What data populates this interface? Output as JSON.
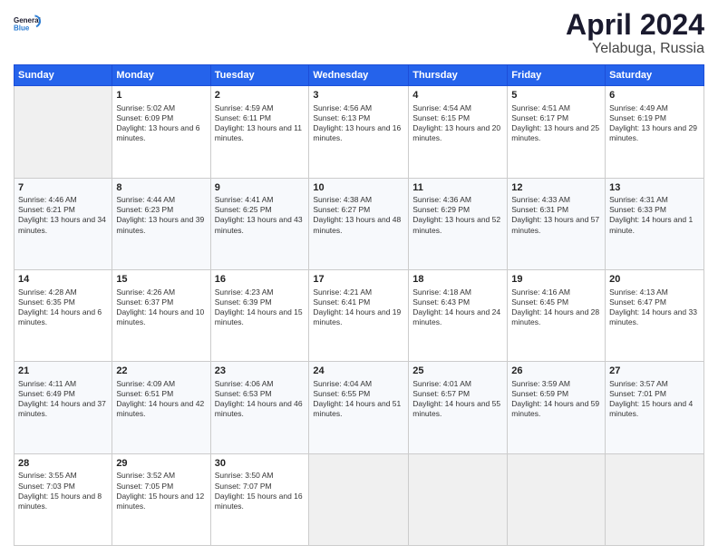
{
  "logo": {
    "text_general": "General",
    "text_blue": "Blue"
  },
  "header": {
    "title": "April 2024",
    "subtitle": "Yelabuga, Russia"
  },
  "weekdays": [
    "Sunday",
    "Monday",
    "Tuesday",
    "Wednesday",
    "Thursday",
    "Friday",
    "Saturday"
  ],
  "weeks": [
    [
      {
        "day": "",
        "empty": true
      },
      {
        "day": "1",
        "sunrise": "Sunrise: 5:02 AM",
        "sunset": "Sunset: 6:09 PM",
        "daylight": "Daylight: 13 hours and 6 minutes."
      },
      {
        "day": "2",
        "sunrise": "Sunrise: 4:59 AM",
        "sunset": "Sunset: 6:11 PM",
        "daylight": "Daylight: 13 hours and 11 minutes."
      },
      {
        "day": "3",
        "sunrise": "Sunrise: 4:56 AM",
        "sunset": "Sunset: 6:13 PM",
        "daylight": "Daylight: 13 hours and 16 minutes."
      },
      {
        "day": "4",
        "sunrise": "Sunrise: 4:54 AM",
        "sunset": "Sunset: 6:15 PM",
        "daylight": "Daylight: 13 hours and 20 minutes."
      },
      {
        "day": "5",
        "sunrise": "Sunrise: 4:51 AM",
        "sunset": "Sunset: 6:17 PM",
        "daylight": "Daylight: 13 hours and 25 minutes."
      },
      {
        "day": "6",
        "sunrise": "Sunrise: 4:49 AM",
        "sunset": "Sunset: 6:19 PM",
        "daylight": "Daylight: 13 hours and 29 minutes."
      }
    ],
    [
      {
        "day": "7",
        "sunrise": "Sunrise: 4:46 AM",
        "sunset": "Sunset: 6:21 PM",
        "daylight": "Daylight: 13 hours and 34 minutes."
      },
      {
        "day": "8",
        "sunrise": "Sunrise: 4:44 AM",
        "sunset": "Sunset: 6:23 PM",
        "daylight": "Daylight: 13 hours and 39 minutes."
      },
      {
        "day": "9",
        "sunrise": "Sunrise: 4:41 AM",
        "sunset": "Sunset: 6:25 PM",
        "daylight": "Daylight: 13 hours and 43 minutes."
      },
      {
        "day": "10",
        "sunrise": "Sunrise: 4:38 AM",
        "sunset": "Sunset: 6:27 PM",
        "daylight": "Daylight: 13 hours and 48 minutes."
      },
      {
        "day": "11",
        "sunrise": "Sunrise: 4:36 AM",
        "sunset": "Sunset: 6:29 PM",
        "daylight": "Daylight: 13 hours and 52 minutes."
      },
      {
        "day": "12",
        "sunrise": "Sunrise: 4:33 AM",
        "sunset": "Sunset: 6:31 PM",
        "daylight": "Daylight: 13 hours and 57 minutes."
      },
      {
        "day": "13",
        "sunrise": "Sunrise: 4:31 AM",
        "sunset": "Sunset: 6:33 PM",
        "daylight": "Daylight: 14 hours and 1 minute."
      }
    ],
    [
      {
        "day": "14",
        "sunrise": "Sunrise: 4:28 AM",
        "sunset": "Sunset: 6:35 PM",
        "daylight": "Daylight: 14 hours and 6 minutes."
      },
      {
        "day": "15",
        "sunrise": "Sunrise: 4:26 AM",
        "sunset": "Sunset: 6:37 PM",
        "daylight": "Daylight: 14 hours and 10 minutes."
      },
      {
        "day": "16",
        "sunrise": "Sunrise: 4:23 AM",
        "sunset": "Sunset: 6:39 PM",
        "daylight": "Daylight: 14 hours and 15 minutes."
      },
      {
        "day": "17",
        "sunrise": "Sunrise: 4:21 AM",
        "sunset": "Sunset: 6:41 PM",
        "daylight": "Daylight: 14 hours and 19 minutes."
      },
      {
        "day": "18",
        "sunrise": "Sunrise: 4:18 AM",
        "sunset": "Sunset: 6:43 PM",
        "daylight": "Daylight: 14 hours and 24 minutes."
      },
      {
        "day": "19",
        "sunrise": "Sunrise: 4:16 AM",
        "sunset": "Sunset: 6:45 PM",
        "daylight": "Daylight: 14 hours and 28 minutes."
      },
      {
        "day": "20",
        "sunrise": "Sunrise: 4:13 AM",
        "sunset": "Sunset: 6:47 PM",
        "daylight": "Daylight: 14 hours and 33 minutes."
      }
    ],
    [
      {
        "day": "21",
        "sunrise": "Sunrise: 4:11 AM",
        "sunset": "Sunset: 6:49 PM",
        "daylight": "Daylight: 14 hours and 37 minutes."
      },
      {
        "day": "22",
        "sunrise": "Sunrise: 4:09 AM",
        "sunset": "Sunset: 6:51 PM",
        "daylight": "Daylight: 14 hours and 42 minutes."
      },
      {
        "day": "23",
        "sunrise": "Sunrise: 4:06 AM",
        "sunset": "Sunset: 6:53 PM",
        "daylight": "Daylight: 14 hours and 46 minutes."
      },
      {
        "day": "24",
        "sunrise": "Sunrise: 4:04 AM",
        "sunset": "Sunset: 6:55 PM",
        "daylight": "Daylight: 14 hours and 51 minutes."
      },
      {
        "day": "25",
        "sunrise": "Sunrise: 4:01 AM",
        "sunset": "Sunset: 6:57 PM",
        "daylight": "Daylight: 14 hours and 55 minutes."
      },
      {
        "day": "26",
        "sunrise": "Sunrise: 3:59 AM",
        "sunset": "Sunset: 6:59 PM",
        "daylight": "Daylight: 14 hours and 59 minutes."
      },
      {
        "day": "27",
        "sunrise": "Sunrise: 3:57 AM",
        "sunset": "Sunset: 7:01 PM",
        "daylight": "Daylight: 15 hours and 4 minutes."
      }
    ],
    [
      {
        "day": "28",
        "sunrise": "Sunrise: 3:55 AM",
        "sunset": "Sunset: 7:03 PM",
        "daylight": "Daylight: 15 hours and 8 minutes."
      },
      {
        "day": "29",
        "sunrise": "Sunrise: 3:52 AM",
        "sunset": "Sunset: 7:05 PM",
        "daylight": "Daylight: 15 hours and 12 minutes."
      },
      {
        "day": "30",
        "sunrise": "Sunrise: 3:50 AM",
        "sunset": "Sunset: 7:07 PM",
        "daylight": "Daylight: 15 hours and 16 minutes."
      },
      {
        "day": "",
        "empty": true
      },
      {
        "day": "",
        "empty": true
      },
      {
        "day": "",
        "empty": true
      },
      {
        "day": "",
        "empty": true
      }
    ]
  ]
}
